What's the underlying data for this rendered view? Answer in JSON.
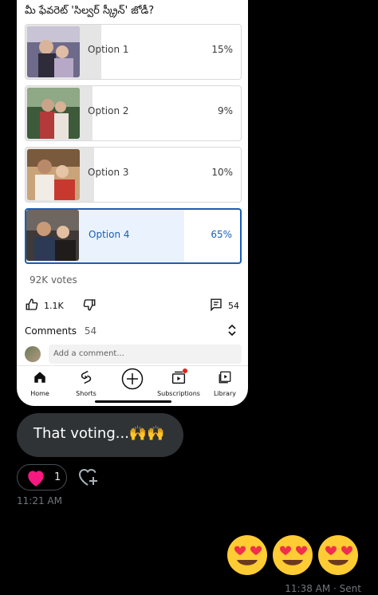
{
  "post": {
    "question": "మీ ఫేవరెట్ 'సిల్వర్ స్క్రీన్' జోడీ?",
    "options": [
      {
        "label": "Option 1",
        "percent": "15%",
        "fill": 15
      },
      {
        "label": "Option 2",
        "percent": "9%",
        "fill": 9
      },
      {
        "label": "Option 3",
        "percent": "10%",
        "fill": 10
      },
      {
        "label": "Option 4",
        "percent": "65%",
        "fill": 65,
        "selected": true
      }
    ],
    "votes": "92K votes",
    "likes": "1.1K",
    "comments_count_short": "54",
    "comments_label": "Comments",
    "comments_count": "54",
    "add_comment_placeholder": "Add a comment..."
  },
  "nav": {
    "home": "Home",
    "shorts": "Shorts",
    "subscriptions": "Subscriptions",
    "library": "Library"
  },
  "chat": {
    "message": "That voting...🙌🙌",
    "reaction_count": "1",
    "time_received": "11:21 AM",
    "time_sent": "11:38 AM · Sent",
    "emojis": [
      "😍",
      "😍",
      "😍"
    ]
  },
  "colors": {
    "selected_blue": "#1a5fb4",
    "heart_red": "#f91880",
    "bubble_bg": "#2f3336"
  }
}
